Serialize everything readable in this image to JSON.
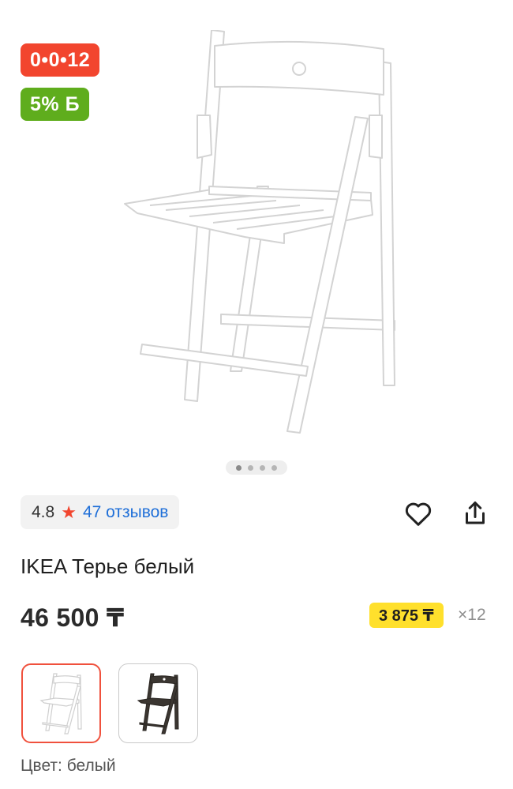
{
  "badges": {
    "installment": "0•0•12",
    "bonus": "5% Б"
  },
  "gallery": {
    "dots_total": 4,
    "active_dot": 1
  },
  "rating": {
    "score": "4.8",
    "star_icon": "star-icon",
    "reviews_text": "47 отзывов"
  },
  "actions": {
    "favorite_icon": "heart-icon",
    "share_icon": "share-icon"
  },
  "product": {
    "title": "IKEA Терье белый",
    "price": "46 500 ₸",
    "installment_price": "3 875 ₸",
    "installment_term": "×12"
  },
  "variants": [
    {
      "name": "белый",
      "selected": true
    },
    {
      "name": "черный",
      "selected": false
    }
  ],
  "color": {
    "label": "Цвет: белый"
  },
  "colors": {
    "installment_badge": "#f2452e",
    "bonus_badge": "#5fad1d",
    "link": "#1f6fd8",
    "installment_highlight": "#ffe02c",
    "selected_border": "#f0513d"
  }
}
